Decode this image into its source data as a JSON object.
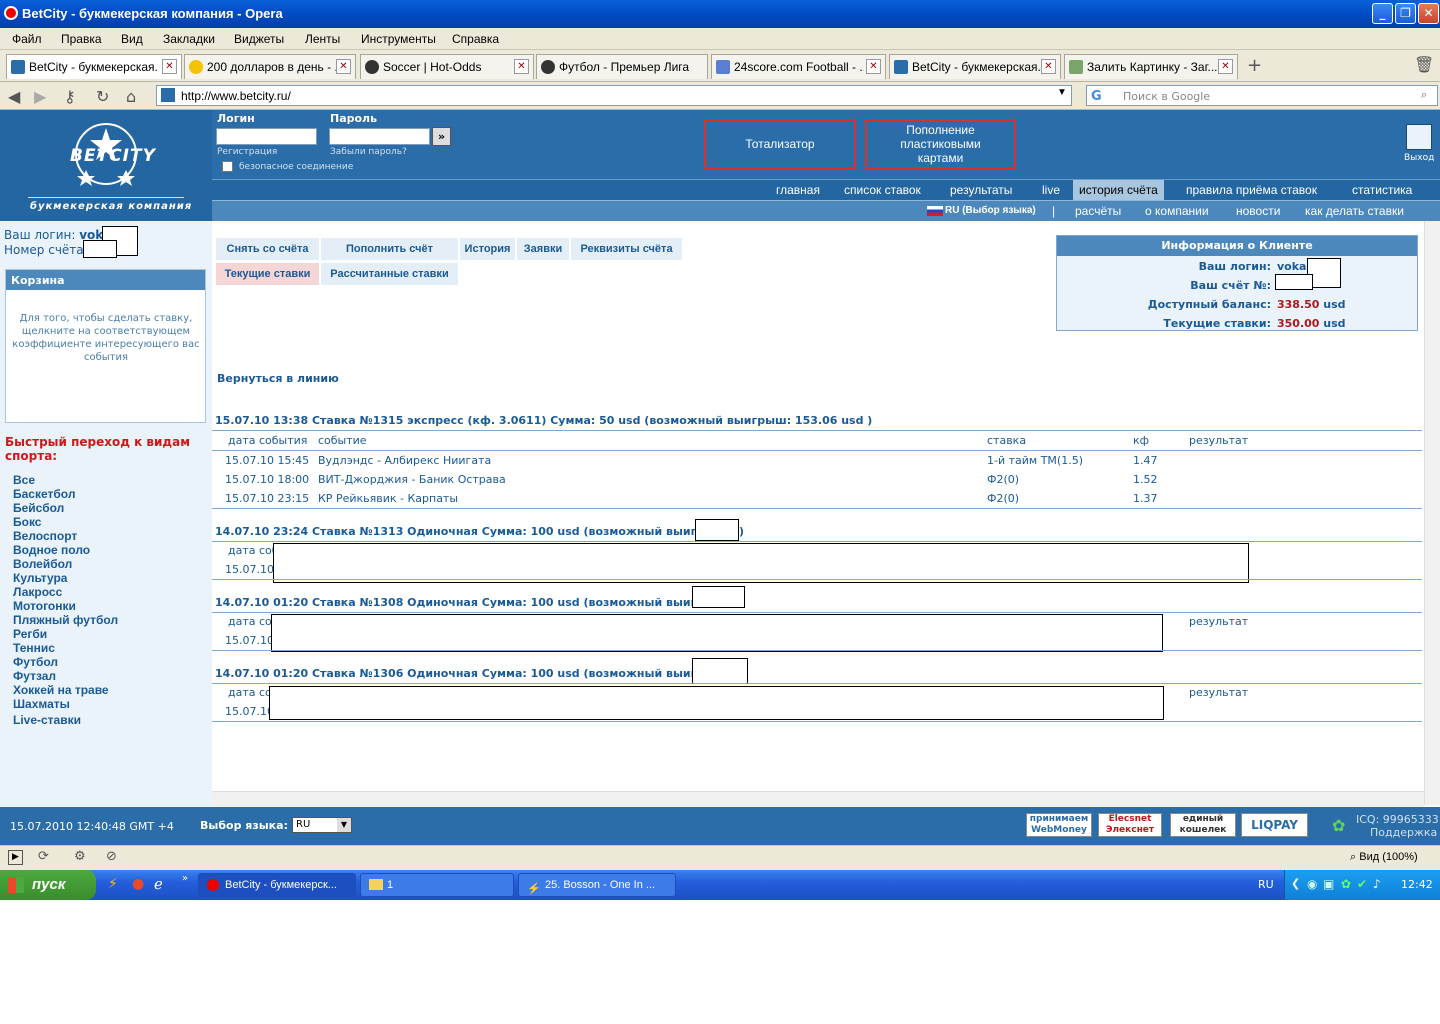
{
  "window": {
    "title": "BetCity - букмекерская компания - Opera"
  },
  "menu": [
    "Файл",
    "Правка",
    "Вид",
    "Закладки",
    "Виджеты",
    "Ленты",
    "Инструменты",
    "Справка"
  ],
  "tabs": [
    {
      "label": "BetCity - букмекерская..."
    },
    {
      "label": "200 долларов в день - ..."
    },
    {
      "label": "Soccer | Hot-Odds"
    },
    {
      "label": "Футбол - Премьер Лига..."
    },
    {
      "label": "24score.com Football - ..."
    },
    {
      "label": "BetCity - букмекерская..."
    },
    {
      "label": "Залить Картинку - Заг..."
    }
  ],
  "address": {
    "url": "http://www.betcity.ru/",
    "search_placeholder": "Поиск в Google"
  },
  "header": {
    "logo_text": "BETCITY",
    "logo_sub": "букмекерская компания",
    "login_label": "Логин",
    "password_label": "Пароль",
    "register": "Регистрация",
    "forgot": "Забыли пароль?",
    "secure": "безопасное соединение",
    "btn_totalizator": "Тотализатор",
    "btn_topup": "Пополнение пластиковыми картами",
    "logout": "Выход"
  },
  "nav1": [
    "главная",
    "список ставок",
    "результаты",
    "live",
    "история счёта",
    "правила приёма ставок",
    "статистика"
  ],
  "nav2": {
    "lang": "RU (Выбор языка)",
    "sep": "|",
    "items": [
      "расчёты",
      "о компании",
      "новости",
      "как делать ставки"
    ]
  },
  "sidebar": {
    "login_label": "Ваш логин:",
    "login_value": "vokal",
    "account_label": "Номер счёта:",
    "basket_title": "Корзина",
    "basket_text": "Для того, чтобы сделать ставку, щелкните на соответствующем коэффициенте интересующего вас события",
    "quick_title": "Быстрый переход к видам спорта:",
    "sports": [
      "Все",
      "Баскетбол",
      "Бейсбол",
      "Бокс",
      "Велоспорт",
      "Водное поло",
      "Волейбол",
      "Культура",
      "Лакросс",
      "Мотогонки",
      "Пляжный футбол",
      "Регби",
      "Теннис",
      "Футбол",
      "Футзал",
      "Хоккей на траве",
      "Шахматы",
      "Live-ставки"
    ]
  },
  "actions": [
    "Снять со счёта",
    "Пополнить счёт",
    "История",
    "Заявки",
    "Реквизиты счёта",
    "Текущие ставки",
    "Рассчитанные ставки"
  ],
  "client_info": {
    "title": "Информация о Клиенте",
    "login_label": "Ваш логин:",
    "login_value": "vokal",
    "account_label": "Ваш счёт №:",
    "balance_label": "Доступный баланс:",
    "balance_value": "338.50",
    "bets_label": "Текущие ставки:",
    "bets_value": "350.00",
    "currency": "usd"
  },
  "back_link": "Вернуться в линию",
  "columns": {
    "date": "дата события",
    "event": "событие",
    "bet": "ставка",
    "kf": "кф",
    "result": "результат",
    "date_short": "дата соб"
  },
  "bets": [
    {
      "header": "15.07.10 13:38  Ставка №1315  экспресс (кф. 3.0611)   Сумма: 50 usd (возможный выигрыш: 153.06 usd )",
      "rows": [
        {
          "date": "15.07.10 15:45",
          "event": "Вудлэндс - Албирекс Ниигата",
          "bet": "1-й тайм ТМ(1.5)",
          "kf": "1.47"
        },
        {
          "date": "15.07.10 18:00",
          "event": "ВИТ-Джорджия - Баник Острава",
          "bet": "Ф2(0)",
          "kf": "1.52"
        },
        {
          "date": "15.07.10 23:15",
          "event": "КР Рейкьявик - Карпаты",
          "bet": "Ф2(0)",
          "kf": "1.37"
        }
      ]
    },
    {
      "header": "14.07.10 23:24  Ставка №1313  Одиночная  Сумма: 100 usd (возможный выигрыш:",
      "tail": ")",
      "row_date": "15.07.10"
    },
    {
      "header": "14.07.10 01:20  Ставка №1308  Одиночная  Сумма: 100 usd (возможный выигрыш:",
      "row_date": "15.07.10"
    },
    {
      "header": "14.07.10 01:20  Ставка №1306  Одиночная  Сумма: 100 usd (возможный выигрыш:",
      "row_date": "15.07.10"
    }
  ],
  "footer": {
    "datetime": "15.07.2010  12:40:48  GMT +4",
    "lang_label": "Выбор языка:",
    "lang_value": "RU",
    "icq": "ICQ: 99965333",
    "support": "Поддержка",
    "pay": [
      "принимаем WebMoney",
      "Elecsnet Элекснет",
      "единый кошелек",
      "LIQPAY"
    ]
  },
  "statusbar": {
    "zoom": "Вид (100%)"
  },
  "taskbar": {
    "start": "пуск",
    "tasks": [
      "BetCity - букмекерск...",
      "1",
      "25. Bosson - One In ..."
    ],
    "lang": "RU",
    "clock": "12:42"
  }
}
